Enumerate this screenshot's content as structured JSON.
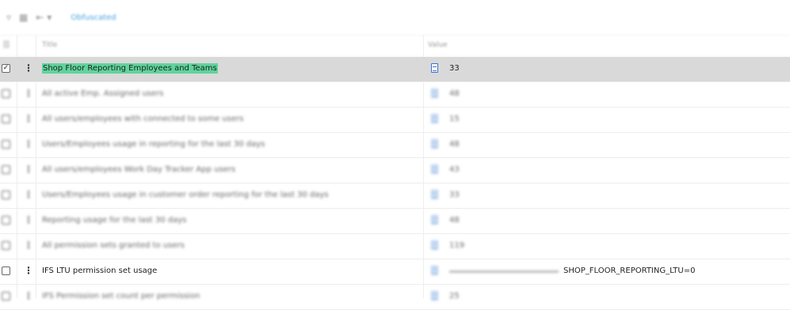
{
  "toolbar": {
    "icons": [
      "filter-icon",
      "columns-icon",
      "export-icon"
    ],
    "link_label": "Obfuscated"
  },
  "table": {
    "col_title": "Title",
    "col_value": "Value",
    "rows": [
      {
        "title": "Shop Floor Reporting Employees and Teams",
        "value": "33",
        "checked": true,
        "selected": true,
        "blurred": false
      },
      {
        "title": "All active Emp. Assigned users",
        "value": "48",
        "blurred": true
      },
      {
        "title": "All users/employees with connected to some users",
        "value": "15",
        "blurred": true
      },
      {
        "title": "Users/Employees usage in reporting for the last 30 days",
        "value": "48",
        "blurred": true
      },
      {
        "title": "All users/employees Work Day Tracker App users",
        "value": "43",
        "blurred": true
      },
      {
        "title": "Users/Employees usage in customer order reporting for the last 30 days",
        "value": "33",
        "blurred": true
      },
      {
        "title": "Reporting usage for the last 30 days",
        "value": "48",
        "blurred": true
      },
      {
        "title": "All permission sets granted to users",
        "value": "119",
        "blurred": true
      },
      {
        "title": "IFS LTU permission set usage",
        "value": "SHOP_FLOOR_REPORTING_LTU=0",
        "blurred": false,
        "value_prefix_blurred": true
      },
      {
        "title": "IFS Permission set count per permission",
        "value": "25",
        "blurred": true
      }
    ]
  }
}
